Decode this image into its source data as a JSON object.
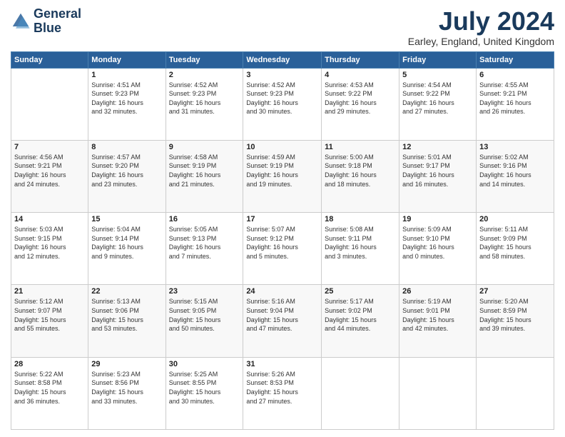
{
  "header": {
    "logo_line1": "General",
    "logo_line2": "Blue",
    "month_title": "July 2024",
    "location": "Earley, England, United Kingdom"
  },
  "weekdays": [
    "Sunday",
    "Monday",
    "Tuesday",
    "Wednesday",
    "Thursday",
    "Friday",
    "Saturday"
  ],
  "weeks": [
    [
      {
        "day": "",
        "info": ""
      },
      {
        "day": "1",
        "info": "Sunrise: 4:51 AM\nSunset: 9:23 PM\nDaylight: 16 hours\nand 32 minutes."
      },
      {
        "day": "2",
        "info": "Sunrise: 4:52 AM\nSunset: 9:23 PM\nDaylight: 16 hours\nand 31 minutes."
      },
      {
        "day": "3",
        "info": "Sunrise: 4:52 AM\nSunset: 9:23 PM\nDaylight: 16 hours\nand 30 minutes."
      },
      {
        "day": "4",
        "info": "Sunrise: 4:53 AM\nSunset: 9:22 PM\nDaylight: 16 hours\nand 29 minutes."
      },
      {
        "day": "5",
        "info": "Sunrise: 4:54 AM\nSunset: 9:22 PM\nDaylight: 16 hours\nand 27 minutes."
      },
      {
        "day": "6",
        "info": "Sunrise: 4:55 AM\nSunset: 9:21 PM\nDaylight: 16 hours\nand 26 minutes."
      }
    ],
    [
      {
        "day": "7",
        "info": "Sunrise: 4:56 AM\nSunset: 9:21 PM\nDaylight: 16 hours\nand 24 minutes."
      },
      {
        "day": "8",
        "info": "Sunrise: 4:57 AM\nSunset: 9:20 PM\nDaylight: 16 hours\nand 23 minutes."
      },
      {
        "day": "9",
        "info": "Sunrise: 4:58 AM\nSunset: 9:19 PM\nDaylight: 16 hours\nand 21 minutes."
      },
      {
        "day": "10",
        "info": "Sunrise: 4:59 AM\nSunset: 9:19 PM\nDaylight: 16 hours\nand 19 minutes."
      },
      {
        "day": "11",
        "info": "Sunrise: 5:00 AM\nSunset: 9:18 PM\nDaylight: 16 hours\nand 18 minutes."
      },
      {
        "day": "12",
        "info": "Sunrise: 5:01 AM\nSunset: 9:17 PM\nDaylight: 16 hours\nand 16 minutes."
      },
      {
        "day": "13",
        "info": "Sunrise: 5:02 AM\nSunset: 9:16 PM\nDaylight: 16 hours\nand 14 minutes."
      }
    ],
    [
      {
        "day": "14",
        "info": "Sunrise: 5:03 AM\nSunset: 9:15 PM\nDaylight: 16 hours\nand 12 minutes."
      },
      {
        "day": "15",
        "info": "Sunrise: 5:04 AM\nSunset: 9:14 PM\nDaylight: 16 hours\nand 9 minutes."
      },
      {
        "day": "16",
        "info": "Sunrise: 5:05 AM\nSunset: 9:13 PM\nDaylight: 16 hours\nand 7 minutes."
      },
      {
        "day": "17",
        "info": "Sunrise: 5:07 AM\nSunset: 9:12 PM\nDaylight: 16 hours\nand 5 minutes."
      },
      {
        "day": "18",
        "info": "Sunrise: 5:08 AM\nSunset: 9:11 PM\nDaylight: 16 hours\nand 3 minutes."
      },
      {
        "day": "19",
        "info": "Sunrise: 5:09 AM\nSunset: 9:10 PM\nDaylight: 16 hours\nand 0 minutes."
      },
      {
        "day": "20",
        "info": "Sunrise: 5:11 AM\nSunset: 9:09 PM\nDaylight: 15 hours\nand 58 minutes."
      }
    ],
    [
      {
        "day": "21",
        "info": "Sunrise: 5:12 AM\nSunset: 9:07 PM\nDaylight: 15 hours\nand 55 minutes."
      },
      {
        "day": "22",
        "info": "Sunrise: 5:13 AM\nSunset: 9:06 PM\nDaylight: 15 hours\nand 53 minutes."
      },
      {
        "day": "23",
        "info": "Sunrise: 5:15 AM\nSunset: 9:05 PM\nDaylight: 15 hours\nand 50 minutes."
      },
      {
        "day": "24",
        "info": "Sunrise: 5:16 AM\nSunset: 9:04 PM\nDaylight: 15 hours\nand 47 minutes."
      },
      {
        "day": "25",
        "info": "Sunrise: 5:17 AM\nSunset: 9:02 PM\nDaylight: 15 hours\nand 44 minutes."
      },
      {
        "day": "26",
        "info": "Sunrise: 5:19 AM\nSunset: 9:01 PM\nDaylight: 15 hours\nand 42 minutes."
      },
      {
        "day": "27",
        "info": "Sunrise: 5:20 AM\nSunset: 8:59 PM\nDaylight: 15 hours\nand 39 minutes."
      }
    ],
    [
      {
        "day": "28",
        "info": "Sunrise: 5:22 AM\nSunset: 8:58 PM\nDaylight: 15 hours\nand 36 minutes."
      },
      {
        "day": "29",
        "info": "Sunrise: 5:23 AM\nSunset: 8:56 PM\nDaylight: 15 hours\nand 33 minutes."
      },
      {
        "day": "30",
        "info": "Sunrise: 5:25 AM\nSunset: 8:55 PM\nDaylight: 15 hours\nand 30 minutes."
      },
      {
        "day": "31",
        "info": "Sunrise: 5:26 AM\nSunset: 8:53 PM\nDaylight: 15 hours\nand 27 minutes."
      },
      {
        "day": "",
        "info": ""
      },
      {
        "day": "",
        "info": ""
      },
      {
        "day": "",
        "info": ""
      }
    ]
  ]
}
